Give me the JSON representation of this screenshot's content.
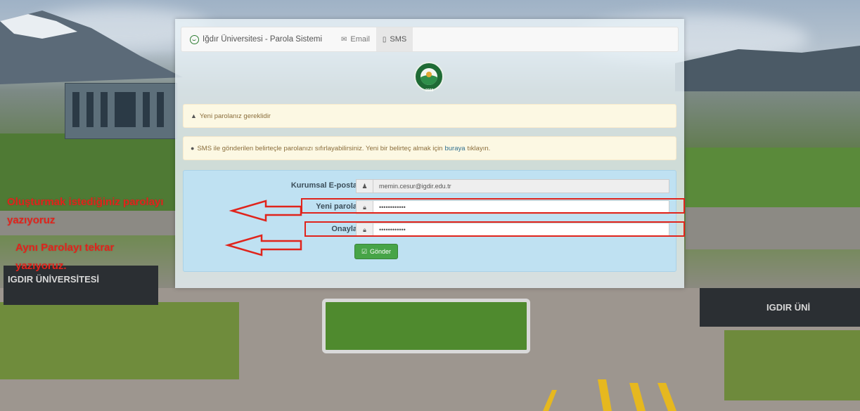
{
  "navbar": {
    "brand": "Iğdır Üniversitesi - Parola Sistemi",
    "tabs": [
      {
        "label": "Email",
        "icon": "envelope-icon"
      },
      {
        "label": "SMS",
        "icon": "mobile-icon"
      }
    ],
    "active_tab": "SMS"
  },
  "logo": {
    "year": "2008"
  },
  "alerts": {
    "required": "Yeni parolanız gereklidir",
    "info_pre": "SMS ile gönderilen belirteçle parolanızı sıfırlayabilirsiniz. Yeni bir belirteç almak için",
    "info_link": "buraya",
    "info_post": "tıklayın."
  },
  "form": {
    "email_label": "Kurumsal E-posta",
    "email_value": "memin.cesur@igdir.edu.tr",
    "new_password_label": "Yeni parola",
    "new_password_value": "••••••••••••",
    "confirm_label": "Onayla",
    "confirm_value": "••••••••••••",
    "submit_label": "Gönder"
  },
  "annotations": {
    "text_1_line_1": "Oluşturmak istediğiniz parolayı",
    "text_1_line_2": "yazıyoruz",
    "text_2_line_1": "Aynı Parolayı tekrar",
    "text_2_line_2": "yazıyoruz."
  },
  "background": {
    "sign_left": "IGDIR ÜNİVERSİTESİ",
    "sign_right": "IGDIR ÜNİ"
  },
  "colors": {
    "annotation_red": "#e0241c",
    "submit_green": "#47a447",
    "alert_yellow": "#fcf8e3",
    "form_blue": "#bfe1f2"
  }
}
